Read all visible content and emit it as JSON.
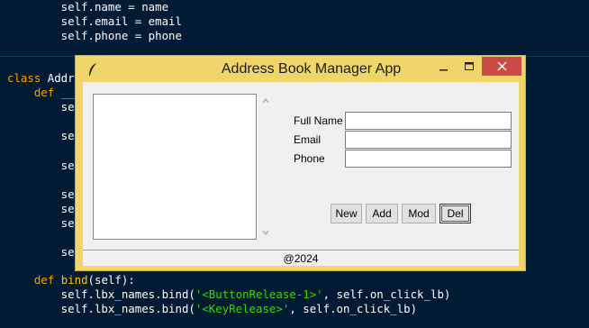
{
  "editor": {
    "lines": [
      {
        "parts": [
          [
            "",
            "        self.name = name"
          ]
        ]
      },
      {
        "parts": [
          [
            "",
            "        self.email = email"
          ]
        ]
      },
      {
        "parts": [
          [
            "",
            "        self.phone = phone"
          ]
        ]
      },
      {
        "parts": [
          [
            "kw",
            "class "
          ],
          [
            "",
            "Addr"
          ]
        ]
      },
      {
        "parts": [
          [
            "kw",
            "    def "
          ],
          [
            "fn",
            "__"
          ]
        ]
      },
      {
        "parts": [
          [
            "",
            "        se"
          ]
        ]
      },
      {
        "parts": [
          [
            "",
            "        se"
          ]
        ]
      },
      {
        "parts": [
          [
            "",
            "        se"
          ]
        ]
      },
      {
        "parts": [
          [
            "",
            "        se"
          ]
        ]
      },
      {
        "parts": [
          [
            "",
            "        se"
          ]
        ]
      },
      {
        "parts": [
          [
            "",
            "        se"
          ]
        ]
      },
      {
        "parts": [
          [
            "",
            "        se"
          ]
        ]
      },
      {
        "parts": [
          [
            "kw",
            "    def "
          ],
          [
            "fn",
            "bind"
          ],
          [
            "",
            "(self):"
          ]
        ]
      },
      {
        "parts": [
          [
            "",
            "        self.lbx_names.bind("
          ],
          [
            "st",
            "'<ButtonRelease-1>'"
          ],
          [
            "",
            ", self.on_click_lb)"
          ]
        ]
      },
      {
        "parts": [
          [
            "",
            "        self.lbx_names.bind("
          ],
          [
            "st",
            "'<KeyRelease>'"
          ],
          [
            "",
            ", self.on_click_lb)"
          ]
        ]
      }
    ]
  },
  "window": {
    "title": "Address Book Manager App",
    "colors": {
      "frame": "#f0d66a",
      "close": "#c94a45",
      "client": "#f0f0f0"
    }
  },
  "form": {
    "full_name_label": "Full Name",
    "email_label": "Email",
    "phone_label": "Phone",
    "full_name_value": "",
    "email_value": "",
    "phone_value": ""
  },
  "buttons": {
    "new": "New",
    "add": "Add",
    "mod": "Mod",
    "del": "Del"
  },
  "status": {
    "text": "@2024"
  },
  "names_list": []
}
